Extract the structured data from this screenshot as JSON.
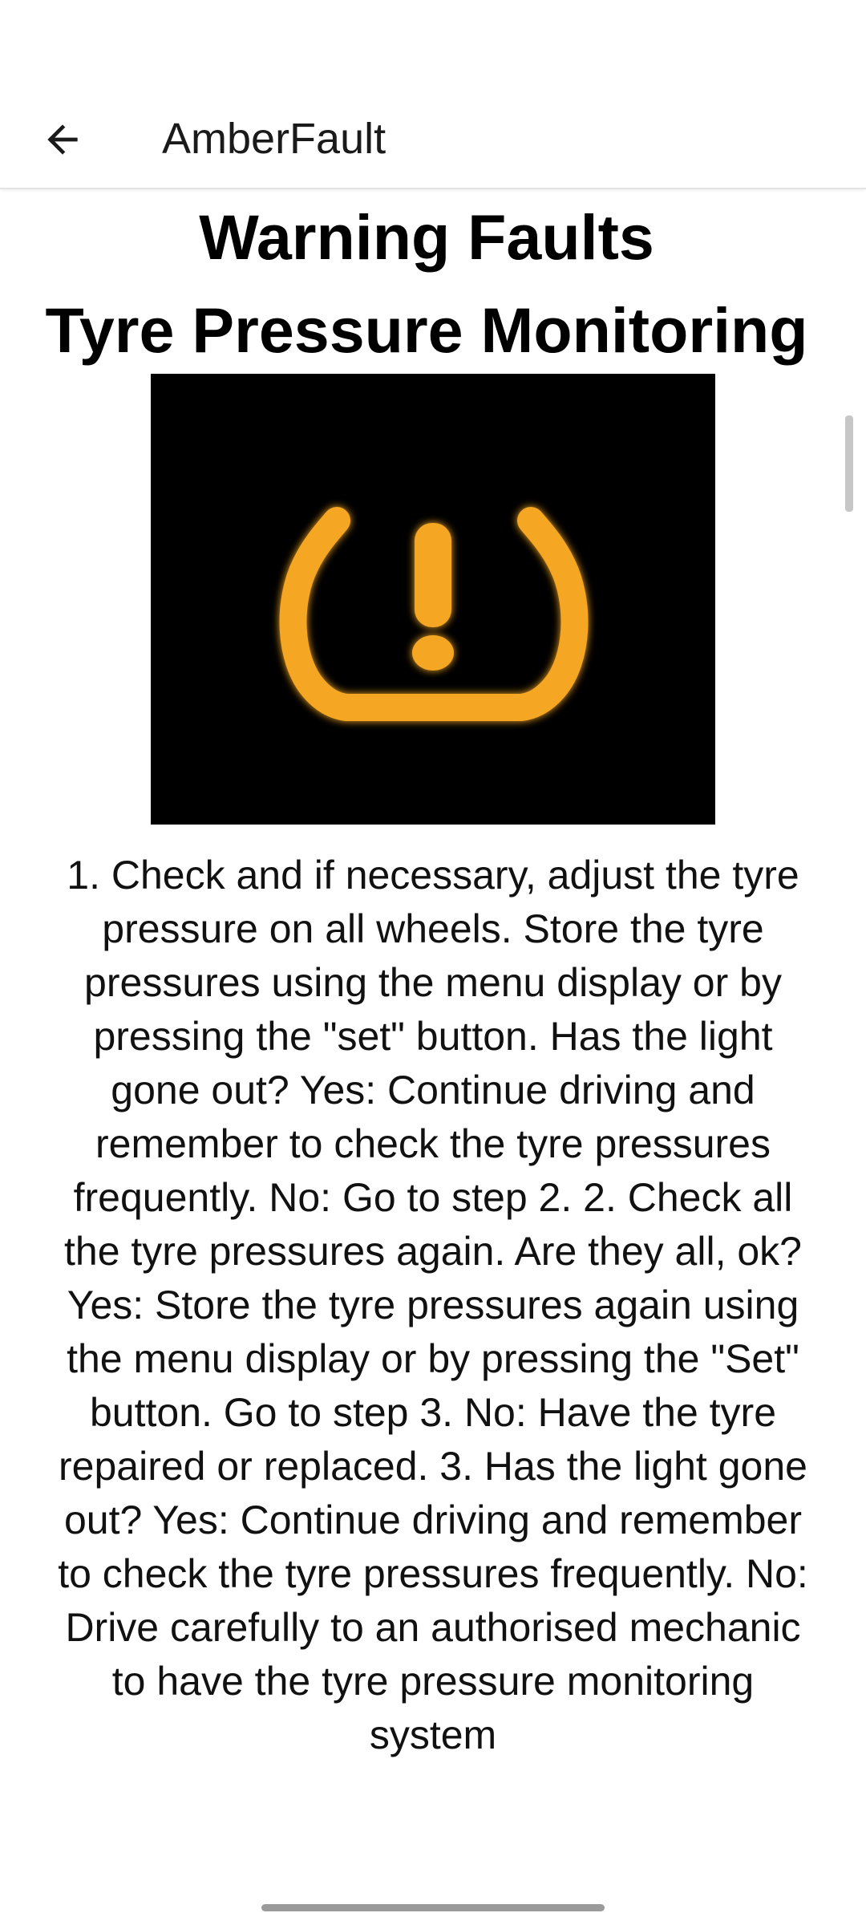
{
  "app_bar": {
    "title": "AmberFault",
    "back_icon": "arrow-left-icon"
  },
  "page": {
    "heading_line1": "Warning Faults",
    "heading_line2": "Tyre Pressure Monitoring",
    "image_icon": "tyre-pressure-warning-icon",
    "icon_color": "#F5A623",
    "image_background": "#000000",
    "body": "1. Check and if necessary, adjust the tyre pressure on all wheels. Store the tyre pressures using the menu display or by pressing the \"set\" button.  Has the light gone out? Yes: Continue driving and remember to check the tyre pressures frequently. No: Go to step 2. 2. Check all the tyre pressures again. Are they all, ok? Yes: Store the tyre pressures again using the menu display or by pressing the \"Set\" button. Go to step 3. No: Have the tyre repaired or replaced. 3. Has the light gone out? Yes: Continue driving and remember to check the tyre pressures frequently. No: Drive carefully to an authorised mechanic to have the tyre pressure monitoring system"
  }
}
